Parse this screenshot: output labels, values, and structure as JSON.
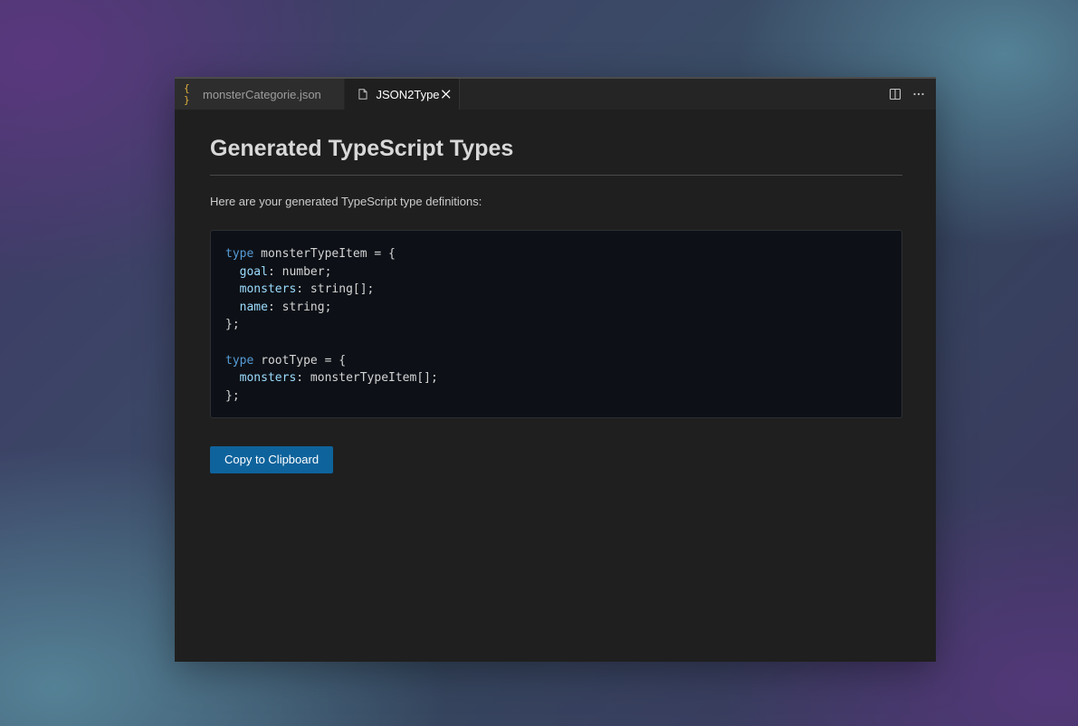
{
  "tabs": [
    {
      "label": "monsterCategorie.json",
      "icon": "json-braces-icon",
      "active": false
    },
    {
      "label": "JSON2Type",
      "icon": "file-icon",
      "active": true
    }
  ],
  "tab_actions": [
    "split-editor-icon",
    "more-actions-icon"
  ],
  "main": {
    "title": "Generated TypeScript Types",
    "intro": "Here are your generated TypeScript type definitions:",
    "code": {
      "language": "typescript",
      "lines": [
        [
          {
            "t": "kw",
            "v": "type"
          },
          {
            "t": "plain",
            "v": " monsterTypeItem = {"
          }
        ],
        [
          {
            "t": "plain",
            "v": "  "
          },
          {
            "t": "prop",
            "v": "goal"
          },
          {
            "t": "plain",
            "v": ": number;"
          }
        ],
        [
          {
            "t": "plain",
            "v": "  "
          },
          {
            "t": "prop",
            "v": "monsters"
          },
          {
            "t": "plain",
            "v": ": string[];"
          }
        ],
        [
          {
            "t": "plain",
            "v": "  "
          },
          {
            "t": "prop",
            "v": "name"
          },
          {
            "t": "plain",
            "v": ": string;"
          }
        ],
        [
          {
            "t": "plain",
            "v": "};"
          }
        ],
        [],
        [
          {
            "t": "kw",
            "v": "type"
          },
          {
            "t": "plain",
            "v": " rootType = {"
          }
        ],
        [
          {
            "t": "plain",
            "v": "  "
          },
          {
            "t": "prop",
            "v": "monsters"
          },
          {
            "t": "plain",
            "v": ": monsterTypeItem[];"
          }
        ],
        [
          {
            "t": "plain",
            "v": "};"
          }
        ]
      ]
    },
    "copy_button_label": "Copy to Clipboard"
  },
  "colors": {
    "accent_button": "#0e639c",
    "keyword": "#569cd6",
    "property": "#9cdcfe",
    "json_icon": "#e2b13c",
    "editor_bg": "#1f1f1f",
    "code_bg": "#0d1117"
  }
}
